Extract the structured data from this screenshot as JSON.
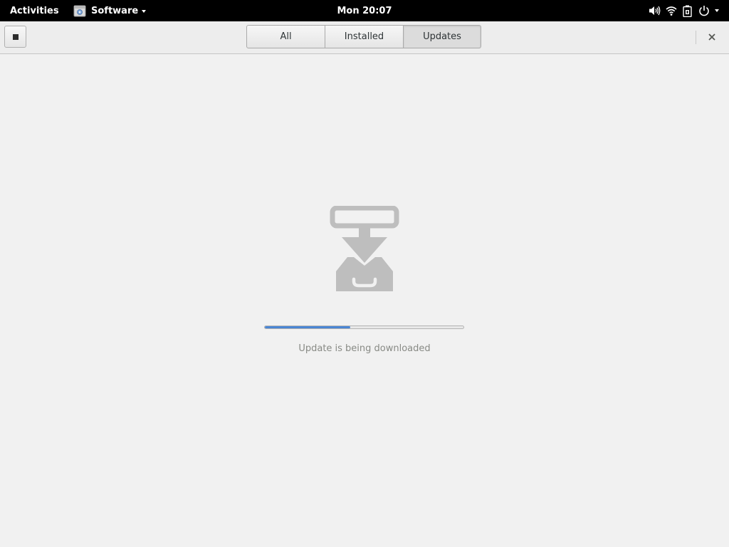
{
  "topbar": {
    "activities_label": "Activities",
    "app_name": "Software",
    "app_icon": "software-icon",
    "clock": "Mon 20:07",
    "tray_icons": [
      "volume-icon",
      "wifi-icon",
      "battery-icon",
      "power-icon"
    ]
  },
  "header": {
    "stop_icon": "stop-icon",
    "tabs": [
      {
        "label": "All",
        "active": false
      },
      {
        "label": "Installed",
        "active": false
      },
      {
        "label": "Updates",
        "active": true
      }
    ],
    "close_icon": "close-icon"
  },
  "main": {
    "illustration_icon": "download-tray-icon",
    "progress_fraction": 0.43,
    "status_text": "Update is being downloaded"
  },
  "colors": {
    "topbar_bg": "#000000",
    "accent": "#4a86d4",
    "icon_gray": "#bebebe"
  }
}
